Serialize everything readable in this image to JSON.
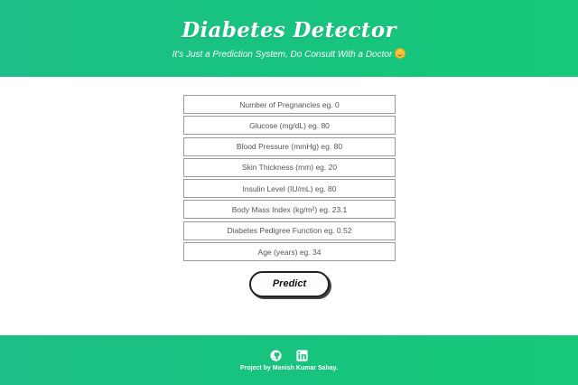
{
  "header": {
    "title": "Diabetes Detector",
    "subtitle": "It's Just a Prediction System, Do Consult With a Doctor"
  },
  "form": {
    "fields": [
      {
        "placeholder": "Number of Pregnancies eg. 0"
      },
      {
        "placeholder": "Glucose (mg/dL) eg. 80"
      },
      {
        "placeholder": "Blood Pressure (mmHg) eg. 80"
      },
      {
        "placeholder": "Skin Thickness (mm) eg. 20"
      },
      {
        "placeholder": "Insulin Level (IU/mL) eg. 80"
      },
      {
        "placeholder": "Body Mass Index (kg/m²) eg. 23.1"
      },
      {
        "placeholder": "Diabetes Pedigree Function eg. 0.52"
      },
      {
        "placeholder": "Age (years) eg. 34"
      }
    ],
    "predict_label": "Predict"
  },
  "footer": {
    "icons": [
      "github-icon",
      "linkedin-icon"
    ],
    "credit": "Project by Manish Kumar Sahay."
  },
  "colors": {
    "accent": "#17c37e",
    "text_on_accent": "#ffffff"
  }
}
